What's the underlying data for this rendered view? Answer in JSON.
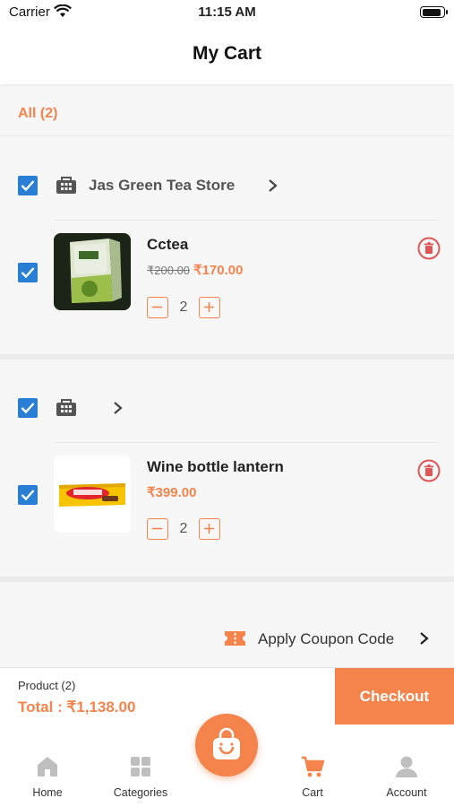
{
  "status_bar": {
    "carrier": "Carrier",
    "time": "11:15 AM",
    "battery_level": 0.95
  },
  "header": {
    "title": "My Cart"
  },
  "filter": {
    "all_label": "All (2)"
  },
  "stores": [
    {
      "store_name": "Jas Green Tea Store",
      "checked": true,
      "items": [
        {
          "name": "Cctea",
          "original_price": "₹200.00",
          "price": "₹170.00",
          "quantity": "2",
          "checked": true
        }
      ]
    },
    {
      "store_name": "",
      "checked": true,
      "items": [
        {
          "name": "Wine bottle lantern",
          "original_price": "",
          "price": "₹399.00",
          "quantity": "2",
          "checked": true
        }
      ]
    }
  ],
  "coupon": {
    "label": "Apply Coupon Code"
  },
  "summary": {
    "product_count": "Product (2)",
    "total": "Total : ₹1,138.00",
    "checkout_label": "Checkout"
  },
  "tabbar": {
    "tabs": [
      {
        "label": "Home",
        "icon": "home-icon",
        "active": false
      },
      {
        "label": "Categories",
        "icon": "categories-icon",
        "active": false
      },
      {
        "label": "Cart",
        "icon": "cart-icon",
        "active": true
      },
      {
        "label": "Account",
        "icon": "account-icon",
        "active": false
      }
    ],
    "center_button_icon": "shopping-bag-icon"
  },
  "colors": {
    "accent": "#f4844c",
    "checkbox": "#2a7fd4",
    "delete": "#e05555"
  }
}
